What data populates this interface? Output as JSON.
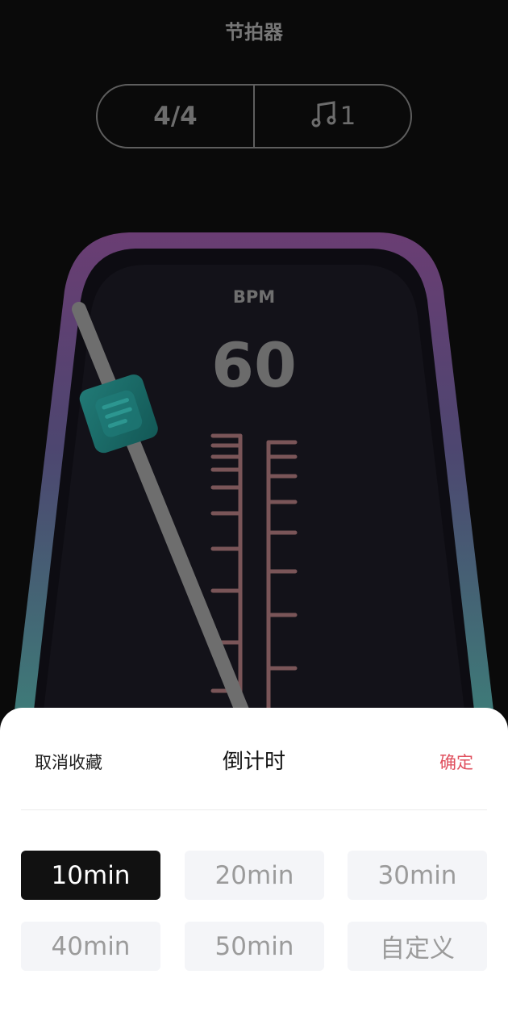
{
  "header": {
    "title": "节拍器"
  },
  "segment": {
    "time_signature": "4/4",
    "note_icon": "music-note-icon",
    "note_count": "1"
  },
  "metronome": {
    "bpm_label": "BPM",
    "bpm_value": "60",
    "colors": {
      "frame_top": "#6a3d73",
      "frame_bottom": "#3e7a78",
      "weight": "#1a6d6b",
      "scale": "#7a5558",
      "pendulum": "#6e6e6e"
    }
  },
  "sheet": {
    "cancel_label": "取消收藏",
    "title": "倒计时",
    "confirm_label": "确定",
    "confirm_color": "#e0505e",
    "options": [
      {
        "label": "10min",
        "selected": true
      },
      {
        "label": "20min",
        "selected": false
      },
      {
        "label": "30min",
        "selected": false
      },
      {
        "label": "40min",
        "selected": false
      },
      {
        "label": "50min",
        "selected": false
      },
      {
        "label": "自定义",
        "selected": false
      }
    ]
  }
}
